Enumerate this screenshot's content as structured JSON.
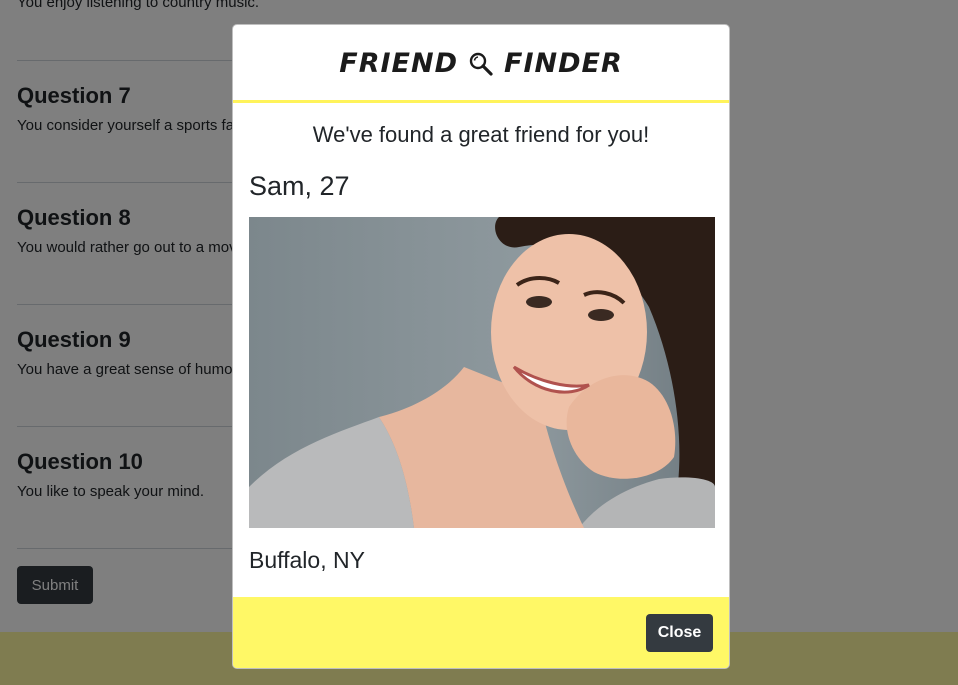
{
  "background": {
    "top_text": "You enjoy listening to country music.",
    "questions": [
      {
        "title": "Question 7",
        "text": "You consider yourself a sports fan."
      },
      {
        "title": "Question 8",
        "text": "You would rather go out to a movie than stay in."
      },
      {
        "title": "Question 9",
        "text": "You have a great sense of humor."
      },
      {
        "title": "Question 10",
        "text": "You like to speak your mind."
      }
    ],
    "submit_label": "Submit"
  },
  "modal": {
    "brand": "FRIEND",
    "brand_right": "FINDER",
    "brand_icon": "magnifying-glass-icon",
    "subtitle": "We've found a great friend for you!",
    "match": {
      "name_age": "Sam, 27",
      "location": "Buffalo, NY"
    },
    "close_label": "Close"
  },
  "colors": {
    "accent_yellow": "#fff866",
    "button_dark": "#343a40",
    "backdrop": "rgba(0,0,0,0.5)"
  }
}
